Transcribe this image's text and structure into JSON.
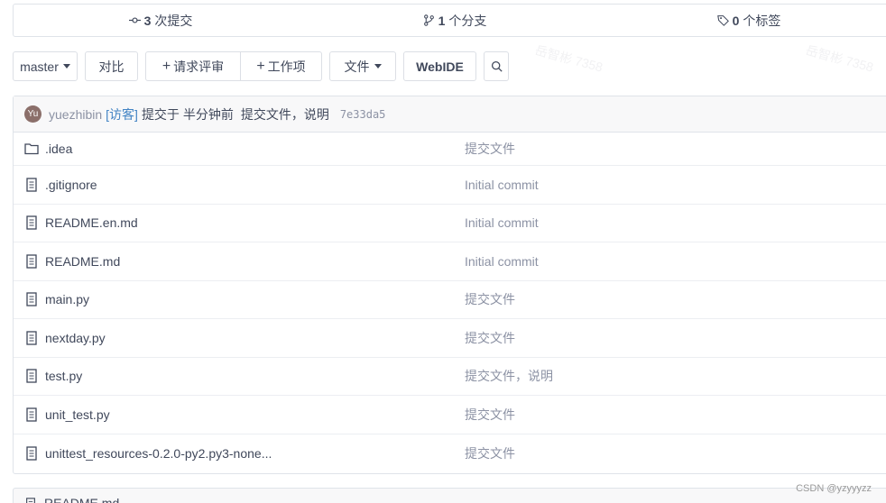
{
  "stats": {
    "commits_count": "3",
    "commits_label": "次提交",
    "branches_count": "1",
    "branches_label": "个分支",
    "tags_count": "0",
    "tags_label": "个标签"
  },
  "toolbar": {
    "branch": "master",
    "compare": "对比",
    "pull_request": "请求评审",
    "work_item": "工作项",
    "file_menu": "文件",
    "webide": "WebIDE"
  },
  "commit": {
    "avatar_text": "Yu",
    "author": "yuezhibin",
    "role": "[访客]",
    "action": "提交于 半分钟前",
    "message": "提交文件，说明",
    "hash": "7e33da5"
  },
  "files": [
    {
      "name": ".idea",
      "commit": "提交文件",
      "type": "folder"
    },
    {
      "name": ".gitignore",
      "commit": "Initial commit",
      "type": "file"
    },
    {
      "name": "README.en.md",
      "commit": "Initial commit",
      "type": "file"
    },
    {
      "name": "README.md",
      "commit": "Initial commit",
      "type": "file"
    },
    {
      "name": "main.py",
      "commit": "提交文件",
      "type": "file"
    },
    {
      "name": "nextday.py",
      "commit": "提交文件",
      "type": "file"
    },
    {
      "name": "test.py",
      "commit": "提交文件，说明",
      "type": "file"
    },
    {
      "name": "unit_test.py",
      "commit": "提交文件",
      "type": "file"
    },
    {
      "name": "unittest_resources-0.2.0-py2.py3-none...",
      "commit": "提交文件",
      "type": "file"
    }
  ],
  "bottom": {
    "label": "README.md"
  },
  "site_watermark": "CSDN @yzyyyzz",
  "watermark_text": "岳智彬 7358"
}
